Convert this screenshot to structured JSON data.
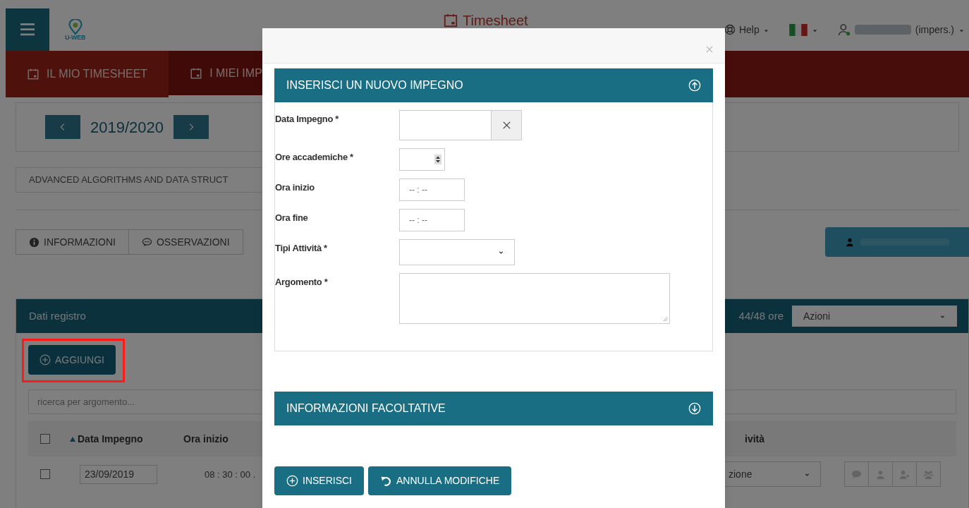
{
  "header": {
    "logo_text": "U-WEB",
    "title": "Timesheet",
    "help": "Help",
    "user_suffix": "(impers.)"
  },
  "nav_tabs": [
    {
      "label": "IL MIO TIMESHEET",
      "selected": true
    },
    {
      "label": "I MIEI IMP",
      "selected": false
    }
  ],
  "year": {
    "value": "2019/2020"
  },
  "course": "ADVANCED ALGORITHMS AND DATA STRUCT",
  "info_tabs": [
    {
      "label": "INFORMAZIONI",
      "kind": "info"
    },
    {
      "label": "OSSERVAZIONI",
      "kind": "comment"
    }
  ],
  "panel": {
    "title": "Dati registro",
    "hours": "44/48 ore",
    "actions": "Azioni",
    "add_button": {
      "label": "AGGIUNGI",
      "highlighted": true
    },
    "search_placeholder": "ricerca per argomento...",
    "header_checked": false,
    "columns": [
      {
        "label": "Data Impegno",
        "sorted": true
      },
      {
        "label": "Ora inizio",
        "sorted": false
      },
      {
        "label": "ività",
        "sorted": false
      }
    ],
    "rows": [
      {
        "checked": false,
        "date": "23/09/2019",
        "start": "08 : 30 : 00 .",
        "activity": "zione"
      }
    ]
  },
  "modal": {
    "sections": [
      {
        "title": "INSERISCI UN NUOVO IMPEGNO",
        "expanded": true
      },
      {
        "title": "INFORMAZIONI FACOLTATIVE",
        "expanded": false
      }
    ],
    "fields": [
      {
        "label": "Data Impegno *",
        "kind": "date"
      },
      {
        "label": "Ore accademiche *",
        "kind": "number"
      },
      {
        "label": "Ora inizio",
        "kind": "time",
        "placeholder": "-- : --"
      },
      {
        "label": "Ora fine",
        "kind": "time",
        "placeholder": "-- : --"
      },
      {
        "label": "Tipi Attività *",
        "kind": "select"
      },
      {
        "label": "Argomento *",
        "kind": "textarea"
      }
    ],
    "buttons": [
      {
        "label": "INSERISCI",
        "kind": "insert"
      },
      {
        "label": "ANNULLA MODIFICHE",
        "kind": "undo"
      }
    ]
  }
}
